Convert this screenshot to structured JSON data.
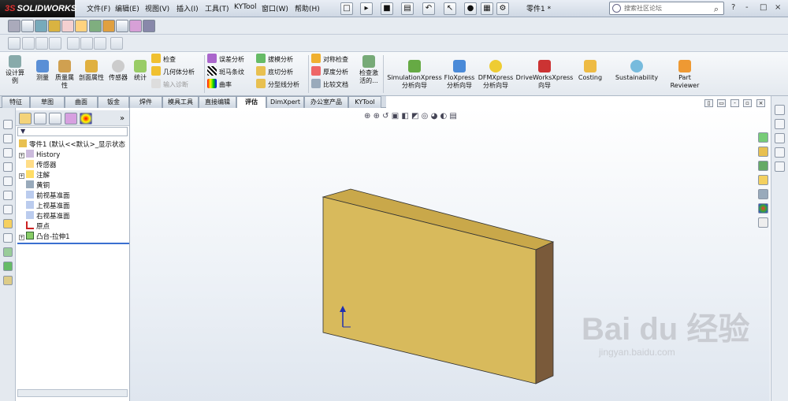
{
  "app": {
    "logo_text": "SOLIDWORKS",
    "logo_prefix": "3S",
    "doc_title": "零件1 *"
  },
  "menu": [
    "文件(F)",
    "编辑(E)",
    "视图(V)",
    "插入(I)",
    "工具(T)",
    "KYTool",
    "窗口(W)",
    "帮助(H)"
  ],
  "search": {
    "placeholder": "搜索社区论坛"
  },
  "window_controls": [
    "?",
    "-",
    "□",
    "×"
  ],
  "command_manager": {
    "big_buttons": [
      "设计算例",
      "测量",
      "质量属性",
      "剖面属性",
      "传感器",
      "统计"
    ],
    "group1": [
      "检查",
      "几何体分析",
      "输入诊断"
    ],
    "group2": [
      "误差分析",
      "斑马条纹",
      "曲率"
    ],
    "group3": [
      "拔模分析",
      "底切分析",
      "分型线分析"
    ],
    "group4": [
      "对称检查",
      "厚度分析",
      "比较文档"
    ],
    "check_active": "检查激活的...",
    "xpress": [
      "SimulationXpress 分析向导",
      "FloXpress 分析向导",
      "DFMXpress 分析向导",
      "DriveWorksXpress 向导",
      "Costing",
      "Sustainability",
      "Part Reviewer"
    ]
  },
  "tabs": [
    "特征",
    "草图",
    "曲面",
    "钣金",
    "焊件",
    "模具工具",
    "直接编辑",
    "评估",
    "DimXpert",
    "办公室产品",
    "KYTool"
  ],
  "active_tab": "评估",
  "tree": {
    "root": "零件1 (默认<<默认>_显示状态",
    "nodes": [
      "History",
      "传感器",
      "注解",
      "黄铜",
      "前视基准面",
      "上视基准面",
      "右视基准面",
      "原点",
      "凸台-拉伸1"
    ]
  },
  "watermark": {
    "brand": "Bai du 经验",
    "url": "jingyan.baidu.com"
  },
  "colors": {
    "part_front": "#D8BA5C",
    "part_top": "#C9A84A",
    "part_side": "#7A5A3A",
    "accent": "#1f3f9b"
  }
}
